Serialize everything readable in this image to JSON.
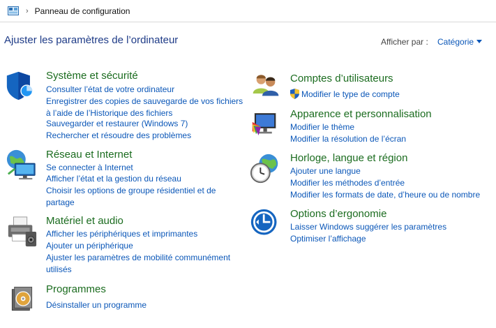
{
  "address": {
    "path": "Panneau de configuration"
  },
  "header": {
    "title": "Ajuster les paramètres de l’ordinateur",
    "view_label": "Afficher par :",
    "view_value": "Catégorie"
  },
  "categories": {
    "system": {
      "title": "Système et sécurité",
      "links": [
        "Consulter l’état de votre ordinateur",
        "Enregistrer des copies de sauvegarde de vos fichiers à l’aide de l’Historique des fichiers",
        "Sauvegarder et restaurer (Windows 7)",
        "Rechercher et résoudre des problèmes"
      ]
    },
    "network": {
      "title": "Réseau et Internet",
      "links": [
        "Se connecter à Internet",
        "Afficher l’état et la gestion du réseau",
        "Choisir les options de groupe résidentiel et de partage"
      ]
    },
    "hardware": {
      "title": "Matériel et audio",
      "links": [
        "Afficher les périphériques et imprimantes",
        "Ajouter un périphérique",
        "Ajuster les paramètres de mobilité communément utilisés"
      ]
    },
    "programs": {
      "title": "Programmes",
      "links": [
        "Désinstaller un programme"
      ]
    },
    "accounts": {
      "title": "Comptes d’utilisateurs",
      "links": [
        "Modifier le type de compte"
      ]
    },
    "appearance": {
      "title": "Apparence et personnalisation",
      "links": [
        "Modifier le thème",
        "Modifier la résolution de l’écran"
      ]
    },
    "clock": {
      "title": "Horloge, langue et région",
      "links": [
        "Ajouter une langue",
        "Modifier les méthodes d’entrée",
        "Modifier les formats de date, d’heure ou de nombre"
      ]
    },
    "ease": {
      "title": "Options d’ergonomie",
      "links": [
        "Laisser Windows suggérer les paramètres",
        "Optimiser l’affichage"
      ]
    }
  }
}
